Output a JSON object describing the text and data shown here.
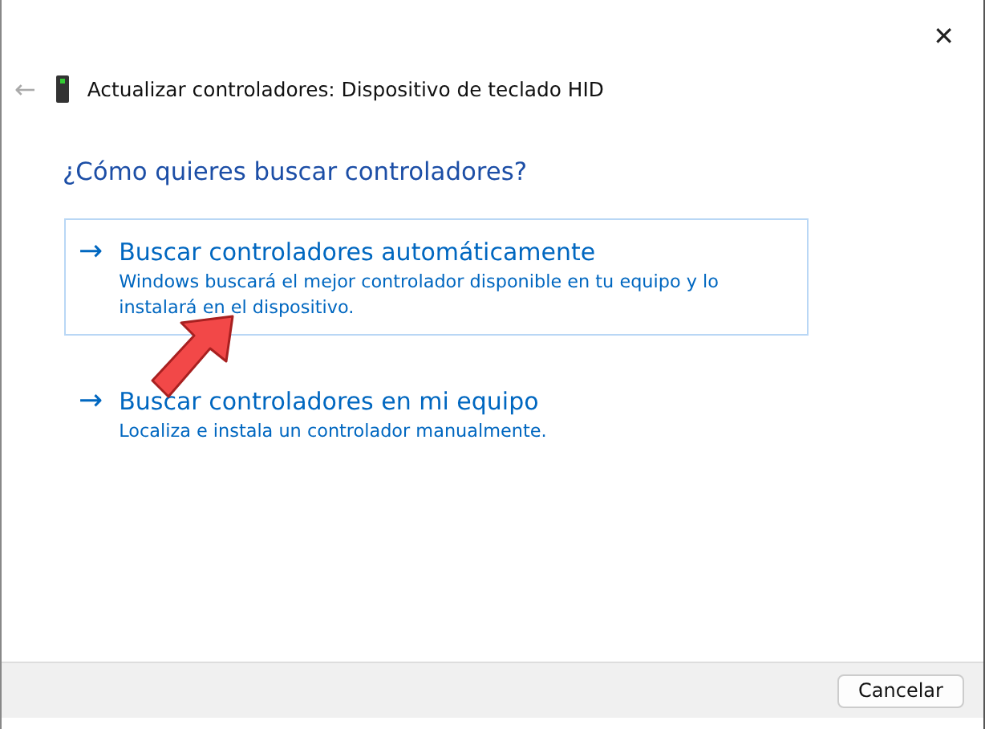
{
  "window": {
    "title": "Actualizar controladores: Dispositivo de teclado HID",
    "close": "✕",
    "back": "←"
  },
  "question": "¿Cómo quieres buscar controladores?",
  "options": [
    {
      "arrow": "→",
      "title": "Buscar controladores automáticamente",
      "description": "Windows buscará el mejor controlador disponible en tu equipo y lo instalará en el dispositivo.",
      "highlighted": true
    },
    {
      "arrow": "→",
      "title": "Buscar controladores en mi equipo",
      "description": "Localiza e instala un controlador manualmente.",
      "highlighted": false
    }
  ],
  "buttons": [
    "Cancelar"
  ]
}
